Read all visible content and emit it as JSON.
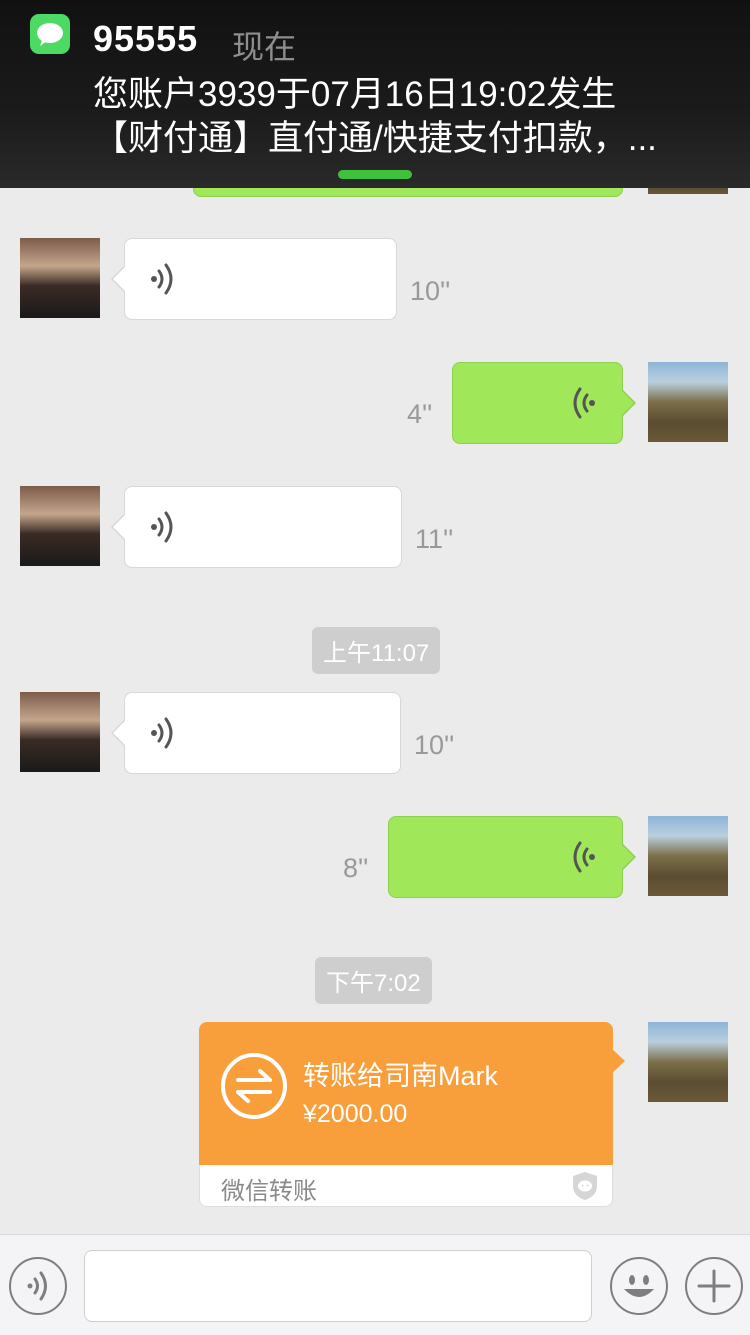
{
  "notification": {
    "sender": "95555",
    "time": "现在",
    "line1": "您账户3939于07月16日19:02发生",
    "line2": "【财付通】直付通/快捷支付扣款，..."
  },
  "messages": [
    {
      "side": "other",
      "type": "voice",
      "duration": "10''"
    },
    {
      "side": "self",
      "type": "voice",
      "duration": "4''"
    },
    {
      "side": "other",
      "type": "voice",
      "duration": "11''"
    },
    {
      "side": "other",
      "type": "voice",
      "duration": "10''"
    },
    {
      "side": "self",
      "type": "voice",
      "duration": "8''"
    }
  ],
  "timestamps": [
    "上午11:07",
    "下午7:02"
  ],
  "transfer": {
    "title": "转账给司南Mark",
    "amount": "¥2000.00",
    "label": "微信转账"
  },
  "colors": {
    "accent_green": "#a0e759",
    "transfer_orange": "#f89e3a",
    "notification_app": "#4cd964"
  },
  "icons": {
    "voice": "voice-wave-icon",
    "emoji": "smiley-icon",
    "plus": "plus-icon",
    "voice_input": "voice-input-icon"
  }
}
